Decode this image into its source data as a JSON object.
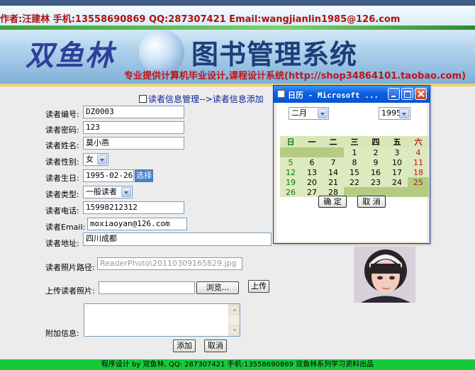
{
  "header": {
    "author_line": "作者:汪建林  手机:13558690869  QQ:287307421 Email:wangjianlin1985@126.com",
    "logo_text": "双鱼林",
    "system_name": "图书管理系统",
    "slogan": "专业提供计算机毕业设计,课程设计系统(http://shop34864101.taobao.com)"
  },
  "breadcrumb": "读者信息管理-->读者信息添加",
  "form": {
    "reader_no_label": "读者编号:",
    "reader_no": "DZ0003",
    "password_label": "读者密码:",
    "password": "123",
    "name_label": "读者姓名:",
    "name": "莫小燕",
    "gender_label": "读者性别:",
    "gender": "女",
    "birthday_label": "读者生日:",
    "birthday": "1995-02-26",
    "choose_button": "选择",
    "type_label": "读者类型:",
    "type": "一般读者",
    "phone_label": "读者电话:",
    "phone": "15998212312",
    "email_label": "读者Email:",
    "email": "moxiaoyan@126.com",
    "address_label": "读者地址:",
    "address": "四川成都",
    "photo_path_label": "读者照片路径:",
    "photo_path": "ReaderPhoto\\20110309165829.jpg",
    "upload_label": "上传读者照片:",
    "browse_button": "浏览...",
    "upload_button": "上传",
    "extra_label": "附加信息:",
    "add_button": "添加",
    "cancel_button": "取消"
  },
  "calendar": {
    "title": "日历 - Microsoft ...",
    "month": "二月",
    "year": "1995",
    "weekdays": [
      "日",
      "一",
      "二",
      "三",
      "四",
      "五",
      "六"
    ],
    "weeks": [
      [
        "",
        "",
        "",
        "1",
        "2",
        "3",
        "4"
      ],
      [
        "5",
        "6",
        "7",
        "8",
        "9",
        "10",
        "11"
      ],
      [
        "12",
        "13",
        "14",
        "15",
        "16",
        "17",
        "18"
      ],
      [
        "19",
        "20",
        "21",
        "22",
        "23",
        "24",
        "25"
      ],
      [
        "26",
        "27",
        "28",
        "",
        "",
        "",
        ""
      ]
    ],
    "ok_button": "确 定",
    "cancel_button": "取 消"
  },
  "footer": "程序设计 by 双鱼林, QQ: 287307421 手机:13558690869 双鱼林系列学习资料出品"
}
